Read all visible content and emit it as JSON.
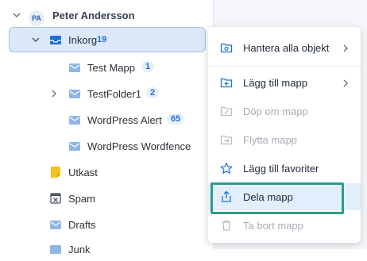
{
  "account": {
    "initials": "PA",
    "name": "Peter Andersson"
  },
  "folders": [
    {
      "label": "Inkorg",
      "count": "19"
    },
    {
      "label": "Test Mapp",
      "count": "1"
    },
    {
      "label": "TestFolder1",
      "count": "2"
    },
    {
      "label": "WordPress Alert",
      "count": "65"
    },
    {
      "label": "WordPress Wordfence",
      "count": ""
    },
    {
      "label": "Utkast",
      "count": ""
    },
    {
      "label": "Spam",
      "count": ""
    },
    {
      "label": "Drafts",
      "count": ""
    },
    {
      "label": "Junk",
      "count": ""
    }
  ],
  "context_menu": {
    "items": [
      {
        "label": "Hantera alla objekt",
        "icon": "manage-folder-icon",
        "enabled": true,
        "submenu": true
      },
      {
        "label": "Lägg till mapp",
        "icon": "add-folder-icon",
        "enabled": true,
        "submenu": true
      },
      {
        "label": "Döp om mapp",
        "icon": "rename-folder-icon",
        "enabled": false,
        "submenu": false
      },
      {
        "label": "Flytta mapp",
        "icon": "move-folder-icon",
        "enabled": false,
        "submenu": false
      },
      {
        "label": "Lägg till favoriter",
        "icon": "star-icon",
        "enabled": true,
        "submenu": false
      },
      {
        "label": "Dela mapp",
        "icon": "share-icon",
        "enabled": true,
        "submenu": false
      },
      {
        "label": "Ta bort mapp",
        "icon": "trash-icon",
        "enabled": false,
        "submenu": false
      }
    ]
  },
  "colors": {
    "accent": "#1d6fd4",
    "highlight_border": "#2f9a86",
    "selected_bg": "#dbe8f8"
  }
}
